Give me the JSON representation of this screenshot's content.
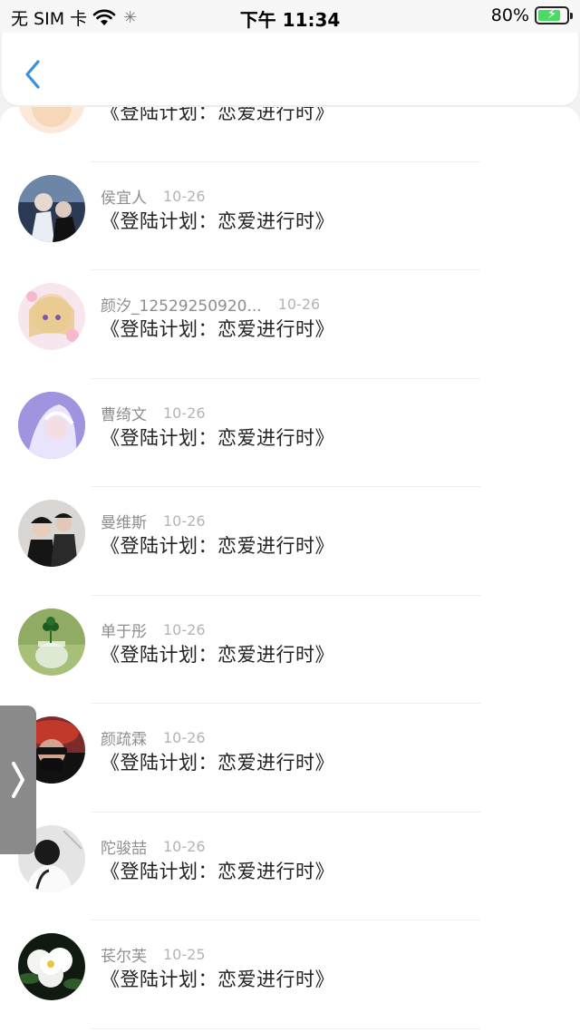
{
  "status_bar": {
    "carrier": "无 SIM 卡",
    "time": "下午 11:34",
    "battery_percent": "80%",
    "battery_level": 0.8
  },
  "nav": {
    "back_icon": "chevron-left-icon",
    "accent_color": "#3b8fe0"
  },
  "list": {
    "items": [
      {
        "name": "",
        "date": "",
        "title": "《登陆计划：恋爱进行时》",
        "avatar": "avatar-cartoon"
      },
      {
        "name": "侯宜人",
        "date": "10-26",
        "title": "《登陆计划：恋爱进行时》",
        "avatar": "avatar-costume-pair"
      },
      {
        "name": "颜汐_12529250920...",
        "date": "10-26",
        "title": "《登陆计划：恋爱进行时》",
        "avatar": "avatar-anime-girl"
      },
      {
        "name": "曹绮文",
        "date": "10-26",
        "title": "《登陆计划：恋爱进行时》",
        "avatar": "avatar-anime-purple"
      },
      {
        "name": "曼维斯",
        "date": "10-26",
        "title": "《登陆计划：恋爱进行时》",
        "avatar": "avatar-dark-pair"
      },
      {
        "name": "单于彤",
        "date": "10-26",
        "title": "《登陆计划：恋爱进行时》",
        "avatar": "avatar-clover-jar"
      },
      {
        "name": "颜疏霖",
        "date": "10-26",
        "title": "《登陆计划：恋爱进行时》",
        "avatar": "avatar-red-hat"
      },
      {
        "name": "陀骏喆",
        "date": "10-26",
        "title": "《登陆计划：恋爱进行时》",
        "avatar": "avatar-monochrome"
      },
      {
        "name": "苌尔芙",
        "date": "10-25",
        "title": "《登陆计划：恋爱进行时》",
        "avatar": "avatar-white-flower"
      }
    ]
  },
  "side_tab": {
    "icon": "chevron-right-icon"
  }
}
